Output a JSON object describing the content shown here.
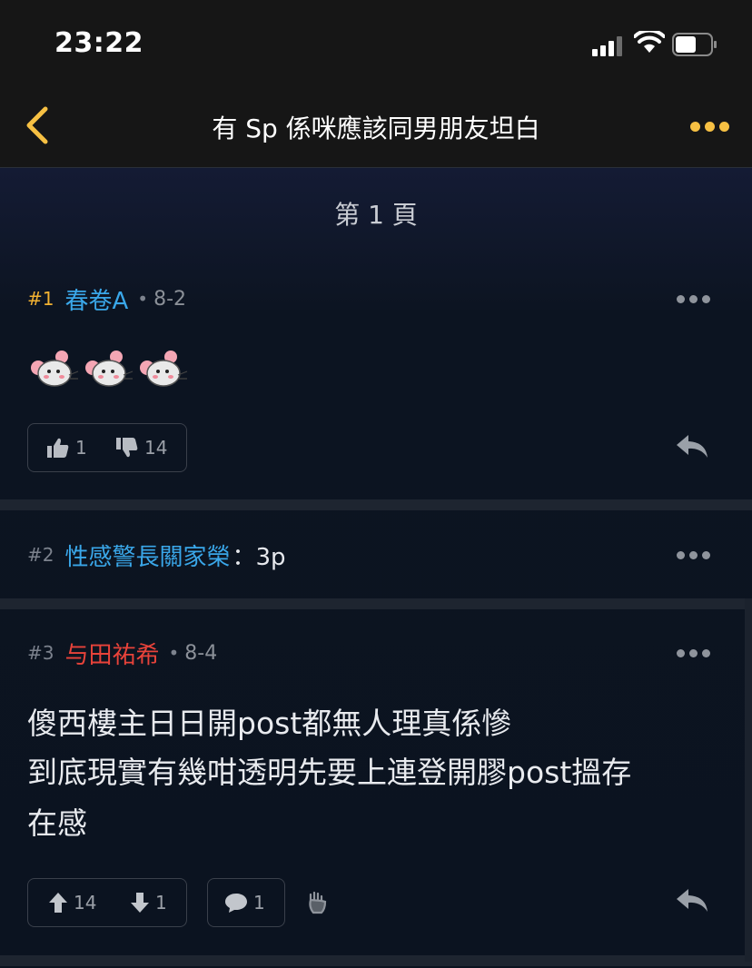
{
  "status_bar": {
    "time": "23:22"
  },
  "nav": {
    "title": "有 Sp 係咪應該同男朋友坦白"
  },
  "page_label": "第 1 頁",
  "posts": [
    {
      "number": "#1",
      "author": "春卷A",
      "date": "8-2",
      "author_color": "#3aa7e9",
      "likes": "1",
      "dislikes": "14",
      "emoji": "rat-face-emoji x3"
    },
    {
      "number": "#2",
      "author": "性感警長關家榮",
      "inline_text": "：3p",
      "author_color": "#3aa7e9"
    },
    {
      "number": "#3",
      "author": "与田祐希",
      "date": "8-4",
      "author_color": "#e8433a",
      "body_lines": [
        "傻西樓主日日開post都無人理真係慘",
        "到底現實有幾咁透明先要上連登開膠post搵存",
        "在感"
      ],
      "upvotes": "14",
      "downvotes": "1",
      "comments": "1"
    }
  ],
  "colors": {
    "accent": "#f6c043",
    "background": "#0c1421",
    "blue_author": "#3aa7e9",
    "red_author": "#e8433a"
  }
}
